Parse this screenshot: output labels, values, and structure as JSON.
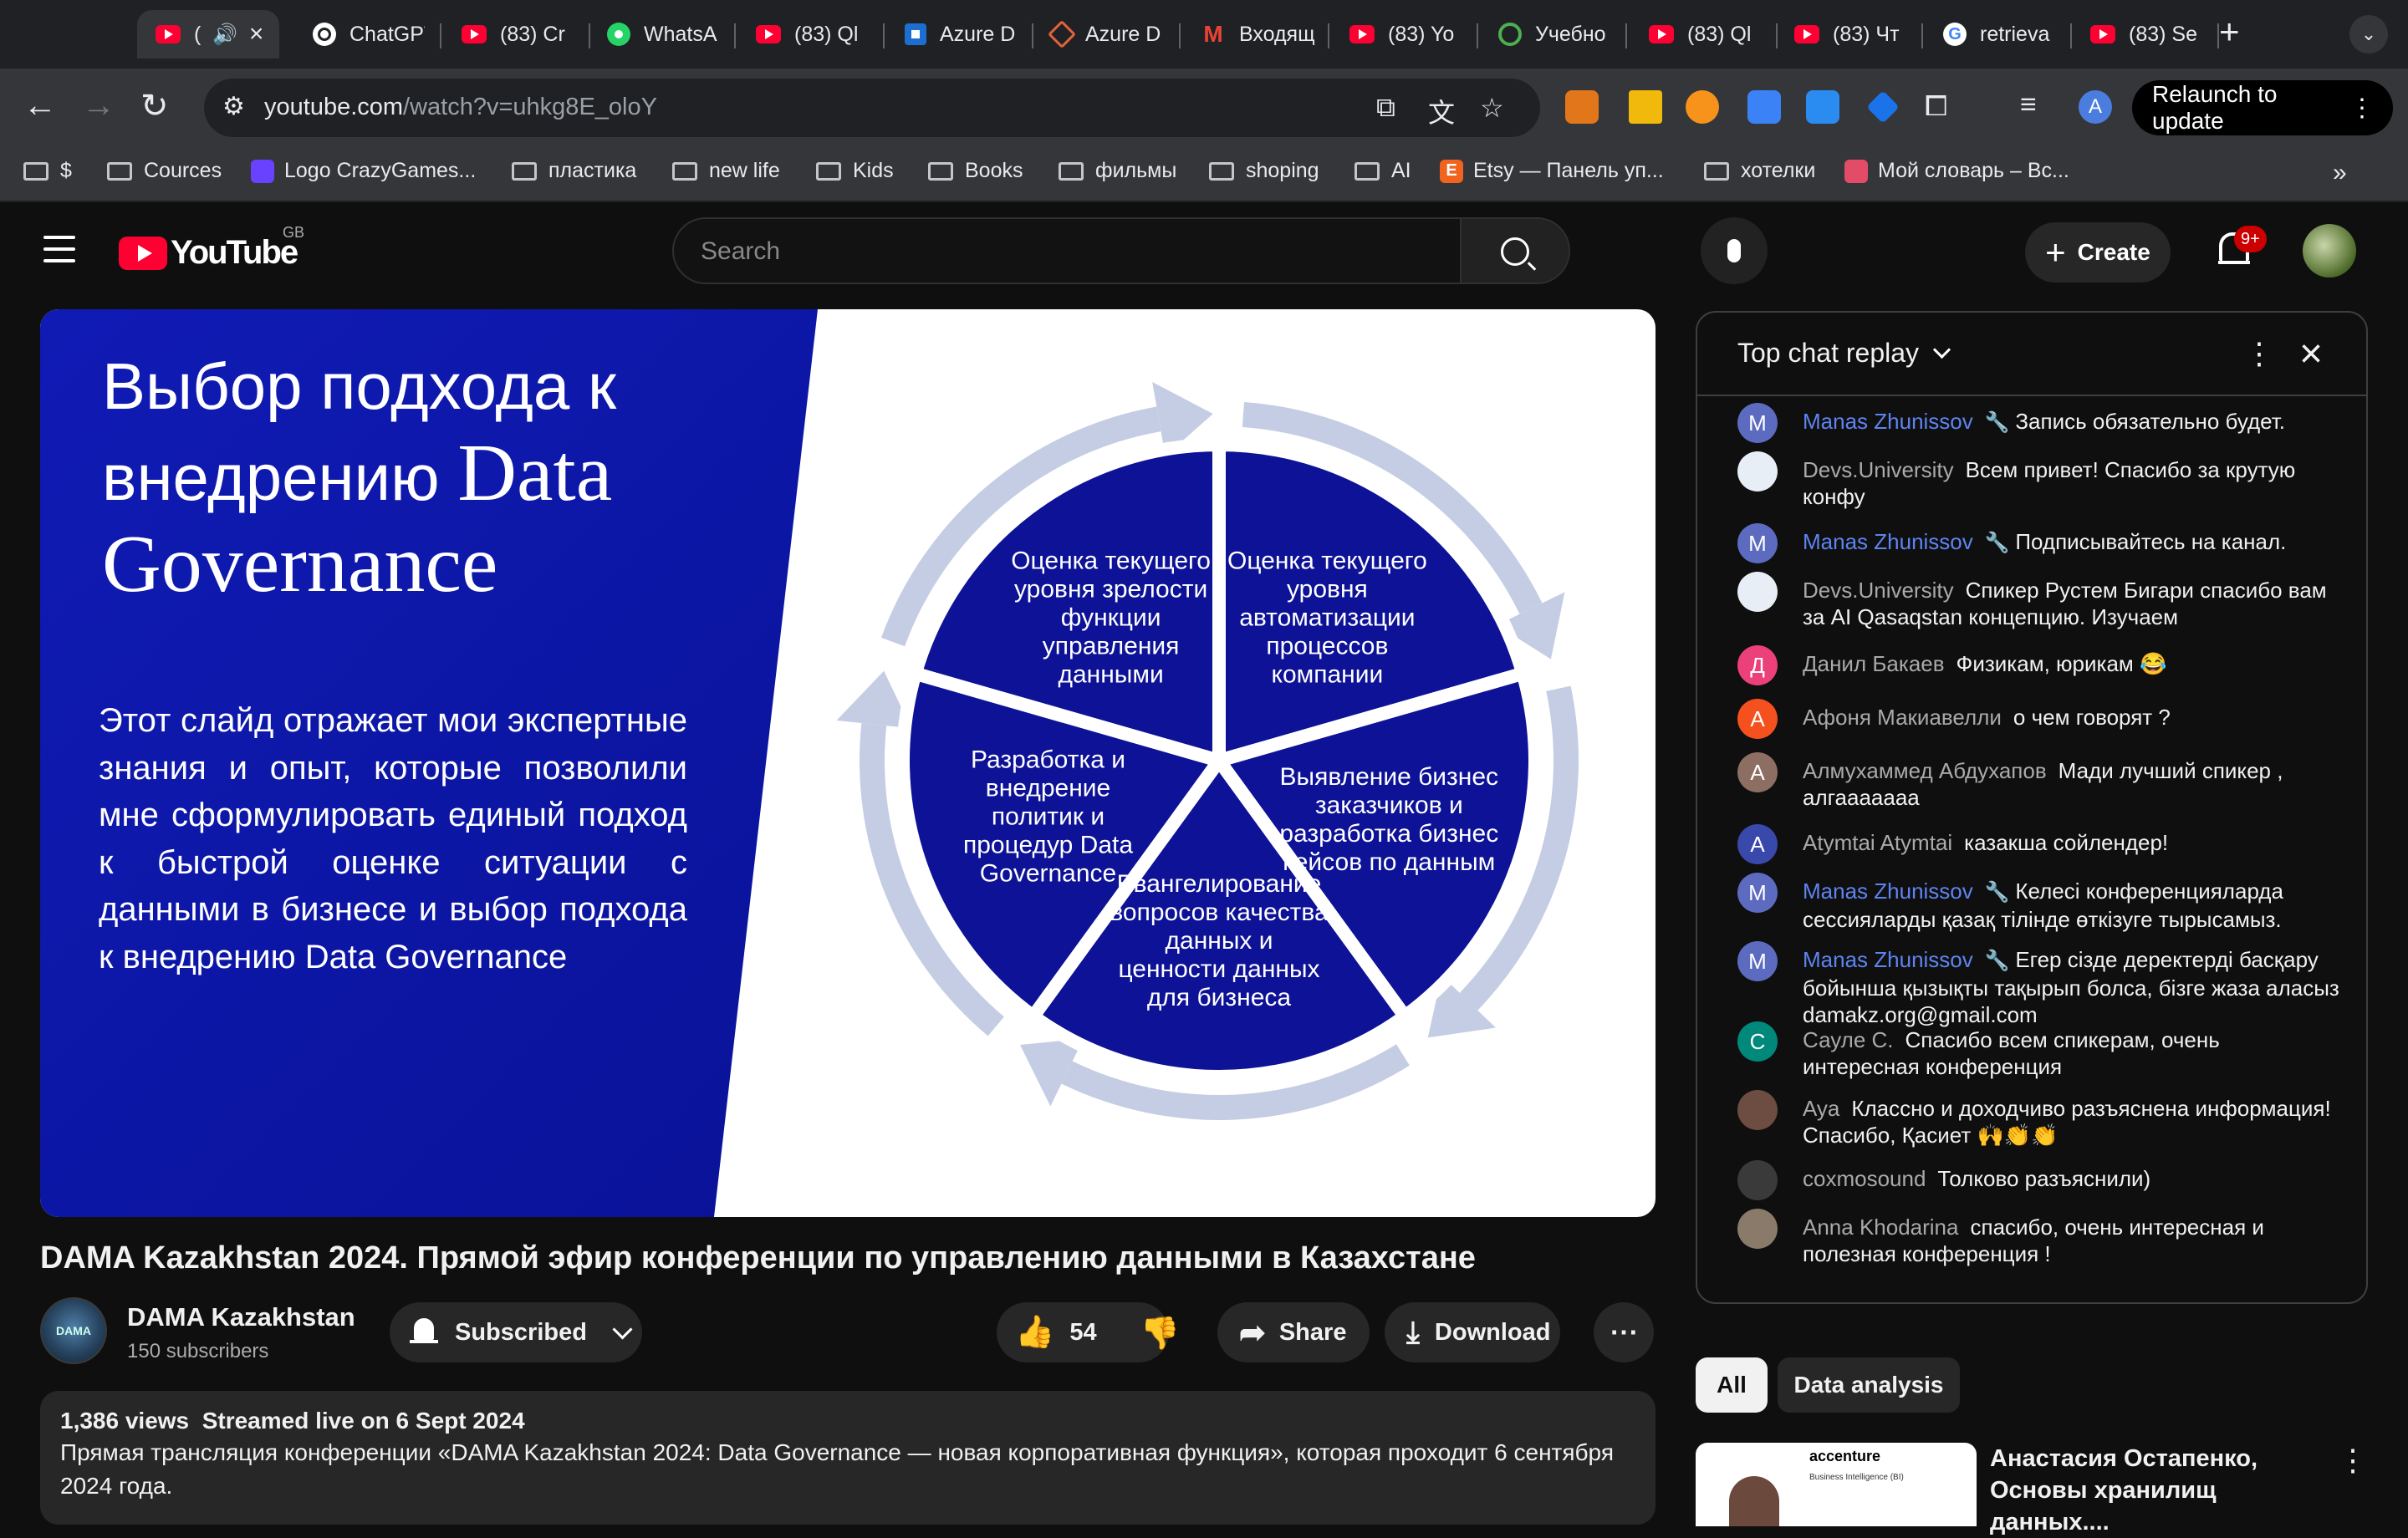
{
  "browser": {
    "tabs": [
      {
        "title": "(",
        "icon": "youtube-icon",
        "active": true
      },
      {
        "title": "ChatGPT",
        "icon": "chatgpt-icon"
      },
      {
        "title": "(83) Cr",
        "icon": "youtube-icon"
      },
      {
        "title": "WhatsA",
        "icon": "whatsapp-icon"
      },
      {
        "title": "(83) Ql",
        "icon": "youtube-icon"
      },
      {
        "title": "Azure D",
        "icon": "azure-icon"
      },
      {
        "title": "Azure D",
        "icon": "azure-devops-icon"
      },
      {
        "title": "Входящ",
        "icon": "gmail-icon"
      },
      {
        "title": "(83) Yo",
        "icon": "youtube-icon"
      },
      {
        "title": "Учебно",
        "icon": "circle-icon"
      },
      {
        "title": "(83) Ql",
        "icon": "youtube-icon"
      },
      {
        "title": "(83) Чт",
        "icon": "youtube-icon"
      },
      {
        "title": "retrieva",
        "icon": "google-icon"
      },
      {
        "title": "(83) Se",
        "icon": "youtube-icon"
      }
    ],
    "url_host": "youtube.com",
    "url_path": "/watch?v=uhkg8E_oloY",
    "relaunch_label": "Relaunch to update",
    "profile_initial": "A",
    "bookmarks": [
      {
        "label": "$",
        "type": "folder"
      },
      {
        "label": "Cources",
        "type": "folder"
      },
      {
        "label": "Logo CrazyGames...",
        "type": "site",
        "icon_color": "#6842ff"
      },
      {
        "label": "пластика",
        "type": "folder"
      },
      {
        "label": "new life",
        "type": "folder"
      },
      {
        "label": "Kids",
        "type": "folder"
      },
      {
        "label": "Books",
        "type": "folder"
      },
      {
        "label": "фильмы",
        "type": "folder"
      },
      {
        "label": "shoping",
        "type": "folder"
      },
      {
        "label": "AI",
        "type": "folder"
      },
      {
        "label": "Etsy — Панель уп...",
        "type": "site",
        "icon_color": "#f1641e",
        "icon_letter": "E"
      },
      {
        "label": "хотелки",
        "type": "folder"
      },
      {
        "label": "Мой словарь – Вс...",
        "type": "site",
        "icon_color": "#e34c67"
      }
    ]
  },
  "youtube": {
    "logo_text": "YouTube",
    "region": "GB",
    "search_placeholder": "Search",
    "create_label": "Create",
    "notif_count": "9+"
  },
  "slide": {
    "title_line1": "Выбор подхода к",
    "title_line2_a": "внедрению ",
    "title_line2_b": "Data",
    "title_line3": "Governance",
    "body": "Этот слайд отражает мои экспертные знания и опыт, которые позволили мне сформулировать единый подход к быстрой оценке ситуации с данными в бизнесе и выбор подхода к внедрению Data Governance",
    "segments": [
      {
        "lines": [
          "Оценка текущего",
          "уровня зрелости",
          "функции",
          "управления",
          "данными"
        ]
      },
      {
        "lines": [
          "Оценка текущего",
          "уровня",
          "автоматизации",
          "процессов",
          "компании"
        ]
      },
      {
        "lines": [
          "Выявление бизнес",
          "заказчиков и",
          "разработка бизнес",
          "кейсов по данным"
        ]
      },
      {
        "lines": [
          "Евангелирование",
          "вопросов качества",
          "данных и",
          "ценности данных",
          "для бизнеса"
        ]
      },
      {
        "lines": [
          "Разработка и",
          "внедрение",
          "политик и",
          "процедур Data",
          "Governance"
        ]
      }
    ],
    "colors": {
      "ring": "#c4cde3",
      "pie": "#0d1296",
      "left_bg": "#0c17a6"
    }
  },
  "video": {
    "title": "DAMA Kazakhstan 2024. Прямой эфир конференции по управлению данными в Казахстане",
    "channel": "DAMA Kazakhstan",
    "subscribers": "150 subscribers",
    "subscribed_label": "Subscribed",
    "likes": "54",
    "share_label": "Share",
    "download_label": "Download",
    "views": "1,386 views",
    "streamed": "Streamed live on 6 Sept 2024",
    "description": "Прямая трансляция конференции «DAMA Kazakhstan 2024: Data Governance — новая корпоративная функция», которая проходит 6 сентября 2024 года."
  },
  "chat": {
    "title": "Top chat replay",
    "messages": [
      {
        "author": "Manas Zhunissov",
        "mod": true,
        "initial": "M",
        "color": "#5c6bc0",
        "text": "Запись обязательно будет."
      },
      {
        "author": "Devs.University",
        "mod": false,
        "initial": "",
        "color": "#e8eef6",
        "text": "Всем привет! Спасибо за крутую конфу"
      },
      {
        "author": "Manas Zhunissov",
        "mod": true,
        "initial": "M",
        "color": "#5c6bc0",
        "text": "Подписывайтесь на канал."
      },
      {
        "author": "Devs.University",
        "mod": false,
        "initial": "",
        "color": "#e8eef6",
        "text": "Спикер Рустем Бигари спасибо вам за AI Qasaqstan концепцию. Изучаем"
      },
      {
        "author": "Данил Бакаев",
        "mod": false,
        "initial": "Д",
        "color": "#ec407a",
        "text": "Физикам, юрикам 😂"
      },
      {
        "author": "Афоня Макиавелли",
        "mod": false,
        "initial": "А",
        "color": "#f4511e",
        "text": "о чем говорят ?"
      },
      {
        "author": "Алмухаммед Абдухапов",
        "mod": false,
        "initial": "А",
        "color": "#8d6e63",
        "text": "Мади лучший спикер , алгааааааа"
      },
      {
        "author": "Atymtai Atymtai",
        "mod": false,
        "initial": "A",
        "color": "#3949ab",
        "text": "казакша сойлендер!"
      },
      {
        "author": "Manas Zhunissov",
        "mod": true,
        "initial": "M",
        "color": "#5c6bc0",
        "text": "Келесі конференцияларда сессияларды қазақ тілінде өткізуге тырысамыз."
      },
      {
        "author": "Manas Zhunissov",
        "mod": true,
        "initial": "M",
        "color": "#5c6bc0",
        "text": "Егер сізде деректерді басқару бойынша қызықты тақырып болса, бізге жаза аласыз damakz.org@gmail.com"
      },
      {
        "author": "Сауле С.",
        "mod": false,
        "initial": "С",
        "color": "#00897b",
        "text": "Спасибо всем спикерам, очень интересная конференция"
      },
      {
        "author": "Aya",
        "mod": false,
        "initial": "",
        "color": "#6d4c41",
        "text": "Классно и доходчиво разъяснена информация! Спасибо, Қасиет 🙌👏👏"
      },
      {
        "author": "coxmosound",
        "mod": false,
        "initial": "",
        "color": "#3a3a3a",
        "text": "Толково разъяснили)"
      },
      {
        "author": "Anna Khodarina",
        "mod": false,
        "initial": "",
        "color": "#8a7a6a",
        "text": "спасибо, очень интересная и полезная конференция !"
      }
    ]
  },
  "related": {
    "chips": [
      "All",
      "Data analysis"
    ],
    "first_title": "Анастасия Остапенко, Основы хранилищ данных....",
    "thumb_brand": "accenture",
    "thumb_sub": "Business Intelligence (BI)"
  }
}
